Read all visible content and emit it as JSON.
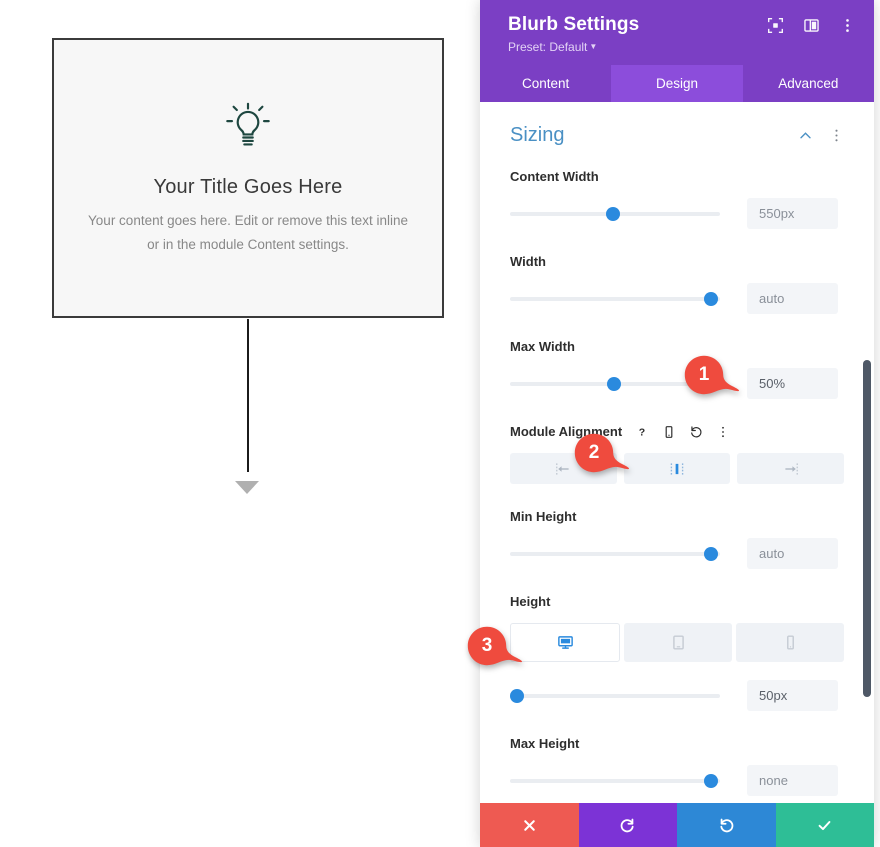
{
  "preview": {
    "icon": "lightbulb-icon",
    "title": "Your Title Goes Here",
    "body": "Your content goes here. Edit or remove this text inline or in the module Content settings.",
    "connector": "vertical-connector-line",
    "arrow": "down-triangle-arrow"
  },
  "panel": {
    "title": "Blurb Settings",
    "preset_label": "Preset: Default",
    "header_icons": [
      "fullscreen-icon",
      "layout-panel-icon",
      "kebab-menu-icon"
    ],
    "tabs": [
      {
        "label": "Content",
        "active": false
      },
      {
        "label": "Design",
        "active": true
      },
      {
        "label": "Advanced",
        "active": false
      }
    ],
    "section": {
      "title": "Sizing",
      "collapse_icon": "chevron-up-icon",
      "menu_icon": "kebab-menu-icon"
    },
    "fields": {
      "content_width": {
        "label": "Content Width",
        "value": "550px",
        "knob_pct": 49
      },
      "width": {
        "label": "Width",
        "value": "auto",
        "knob_pct": 96
      },
      "max_width": {
        "label": "Max Width",
        "value": "50%",
        "knob_pct": 49
      },
      "module_alignment": {
        "label": "Module Alignment",
        "label_icons": [
          "help-icon",
          "responsive-phone-icon",
          "reset-icon",
          "kebab-menu-icon"
        ],
        "options": [
          {
            "name": "align-left",
            "active": false
          },
          {
            "name": "align-center",
            "active": true
          },
          {
            "name": "align-right",
            "active": false
          }
        ]
      },
      "min_height": {
        "label": "Min Height",
        "value": "auto",
        "knob_pct": 96
      },
      "height": {
        "label": "Height",
        "value": "50px",
        "knob_pct": 3,
        "devices": [
          {
            "name": "desktop",
            "active": true
          },
          {
            "name": "tablet",
            "active": false
          },
          {
            "name": "phone",
            "active": false
          }
        ]
      },
      "max_height": {
        "label": "Max Height",
        "value": "none",
        "knob_pct": 96
      }
    },
    "actions": [
      {
        "name": "cancel-button",
        "icon": "close-icon",
        "color": "#ee5a52"
      },
      {
        "name": "undo-button",
        "icon": "undo-icon",
        "color": "#7c33d6"
      },
      {
        "name": "redo-button",
        "icon": "redo-icon",
        "color": "#2d88d6"
      },
      {
        "name": "save-button",
        "icon": "check-icon",
        "color": "#2ebe96"
      }
    ]
  },
  "annotations": [
    {
      "number": "1",
      "target": "max-width-value"
    },
    {
      "number": "2",
      "target": "module-alignment-options"
    },
    {
      "number": "3",
      "target": "height-slider"
    }
  ],
  "colors": {
    "brand_purple": "#7b3fc4",
    "tab_active": "#8c4ddb",
    "section_blue": "#4a90c4",
    "slider_knob": "#2a8ade",
    "badge_red": "#ef4b3e",
    "bulb_teal": "#1e4740"
  }
}
